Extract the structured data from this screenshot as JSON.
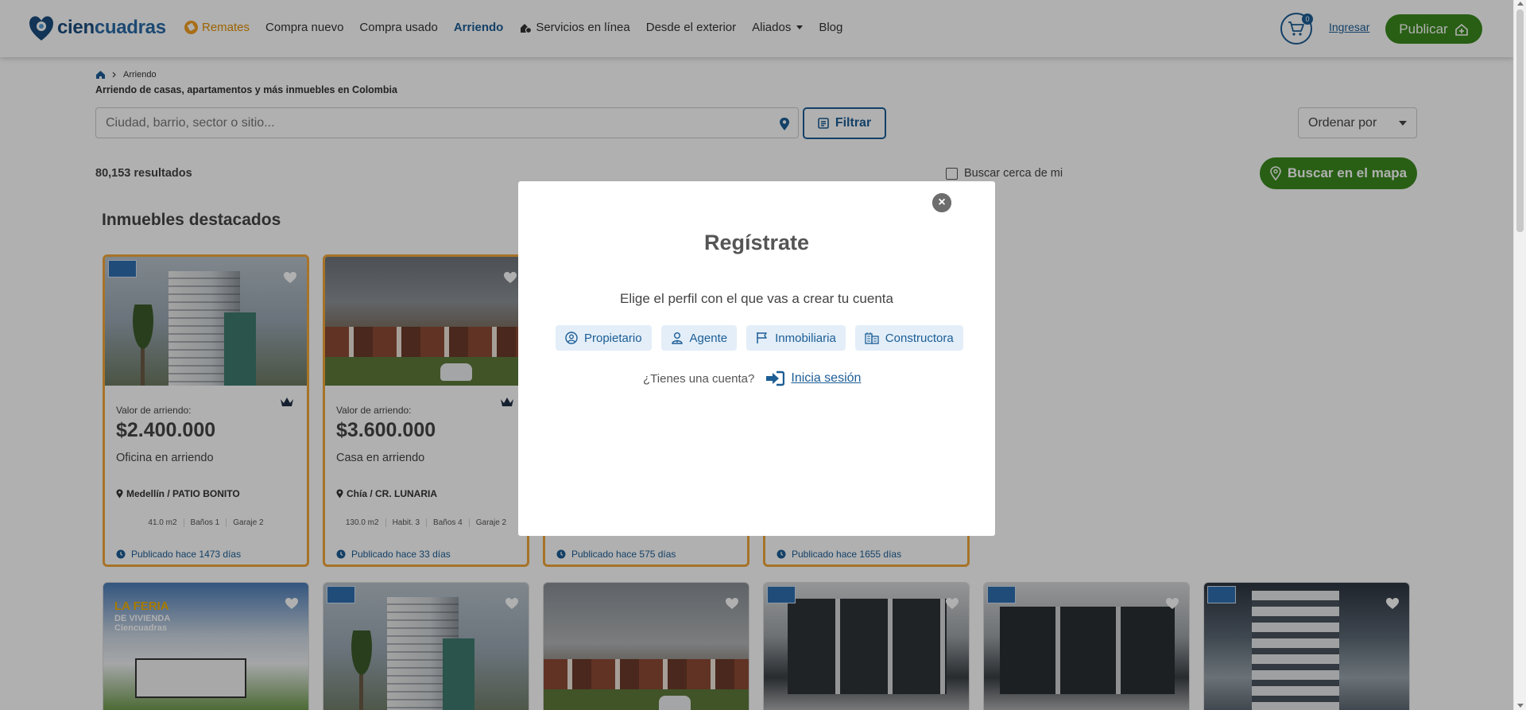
{
  "header": {
    "logo": {
      "part1": "cien",
      "part2": "cuadras"
    },
    "nav": [
      {
        "label": "Remates",
        "icon": "gavel-badge-icon"
      },
      {
        "label": "Compra nuevo"
      },
      {
        "label": "Compra usado"
      },
      {
        "label": "Arriendo",
        "active": true
      },
      {
        "label": "Servicios en línea",
        "icon": "services-icon"
      },
      {
        "label": "Desde el exterior"
      },
      {
        "label": "Aliados",
        "icon": "chevron-down-icon"
      },
      {
        "label": "Blog"
      }
    ],
    "cart_count": "0",
    "login_label": "Ingresar",
    "publish_label": "Publicar"
  },
  "breadcrumb": {
    "current": "Arriendo"
  },
  "subtitle": "Arriendo de casas, apartamentos y más inmuebles en Colombia",
  "search": {
    "placeholder": "Ciudad, barrio, sector o sitio...",
    "value": ""
  },
  "filter_label": "Filtrar",
  "sort_label": "Ordenar por",
  "results_count": "80,153 resultados",
  "near_me_label": "Buscar cerca de mi",
  "map_button_label": "Buscar en el mapa",
  "featured_title": "Inmuebles destacados",
  "featured": [
    {
      "value_label": "Valor de arriendo:",
      "price": "$2.400.000",
      "type": "Oficina en arriendo",
      "location": "Medellín / PATIO BONITO",
      "features": [
        "41.0 m2",
        "Baños 1",
        "Garaje 2"
      ],
      "published": "Publicado hace 1473 días"
    },
    {
      "value_label": "Valor de arriendo:",
      "price": "$3.600.000",
      "type": "Casa en arriendo",
      "location": "Chía / CR. LUNARIA",
      "features": [
        "130.0 m2",
        "Habit. 3",
        "Baños 4",
        "Garaje 2"
      ],
      "published": "Publicado hace 33 días"
    },
    {
      "published": "Publicado hace 575 días"
    },
    {
      "published": "Publicado hace 1655 días"
    }
  ],
  "listing_row2_images": [
    "feria-vivienda",
    "building",
    "houses",
    "facade",
    "facade",
    "tower"
  ],
  "feria_text": [
    "LA FERIA",
    "DE VIVIENDA",
    "Ciencuadras"
  ],
  "modal": {
    "title": "Regístrate",
    "subtitle": "Elige el perfil con el que vas a crear tu cuenta",
    "profiles": [
      {
        "label": "Propietario",
        "icon": "user-circle-icon"
      },
      {
        "label": "Agente",
        "icon": "agent-icon"
      },
      {
        "label": "Inmobiliaria",
        "icon": "flag-icon"
      },
      {
        "label": "Constructora",
        "icon": "building-icon"
      }
    ],
    "have_account": "¿Tienes una cuenta?",
    "login_link": "Inicia sesión"
  },
  "colors": {
    "brand_blue": "#1c5d95",
    "brand_green": "#3a8a1d",
    "remates_orange": "#e49000",
    "card_border": "#f2a73b"
  }
}
